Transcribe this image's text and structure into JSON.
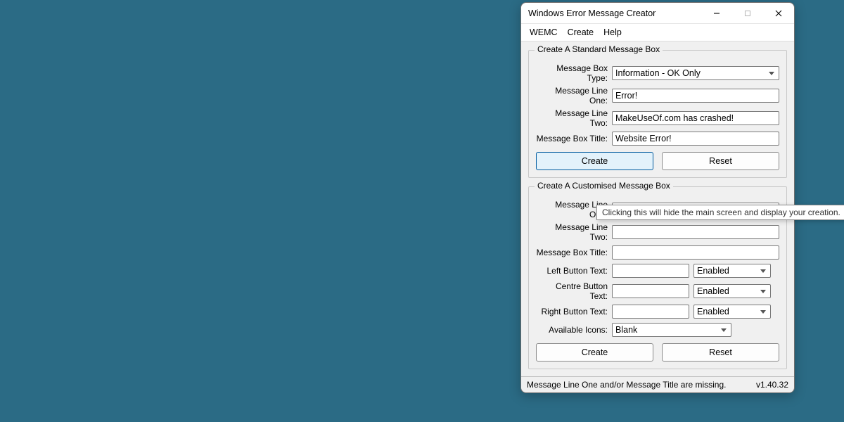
{
  "window": {
    "title": "Windows Error Message Creator"
  },
  "menus": {
    "wemc": "WEMC",
    "create": "Create",
    "help": "Help"
  },
  "standard": {
    "legend": "Create A Standard Message Box",
    "type_label": "Message Box Type:",
    "type_value": "Information - OK Only",
    "line1_label": "Message Line One:",
    "line1_value": "Error!",
    "line2_label": "Message Line Two:",
    "line2_value": "MakeUseOf.com has crashed!",
    "title_label": "Message Box Title:",
    "title_value": "Website Error!",
    "create_btn": "Create",
    "reset_btn": "Reset"
  },
  "custom": {
    "legend": "Create A Customised Message Box",
    "line1_label": "Message Line One:",
    "line1_value": "",
    "line2_label": "Message Line Two:",
    "line2_value": "",
    "title_label": "Message Box Title:",
    "title_value": "",
    "left_label": "Left Button Text:",
    "left_value": "",
    "left_state": "Enabled",
    "centre_label": "Centre Button Text:",
    "centre_value": "",
    "centre_state": "Enabled",
    "right_label": "Right Button Text:",
    "right_value": "",
    "right_state": "Enabled",
    "icons_label": "Available Icons:",
    "icons_value": "Blank",
    "create_btn": "Create",
    "reset_btn": "Reset"
  },
  "tooltip": "Clicking this will hide the main screen and display your creation.",
  "status": {
    "message": "Message Line One and/or Message Title are missing.",
    "version": "v1.40.32"
  }
}
